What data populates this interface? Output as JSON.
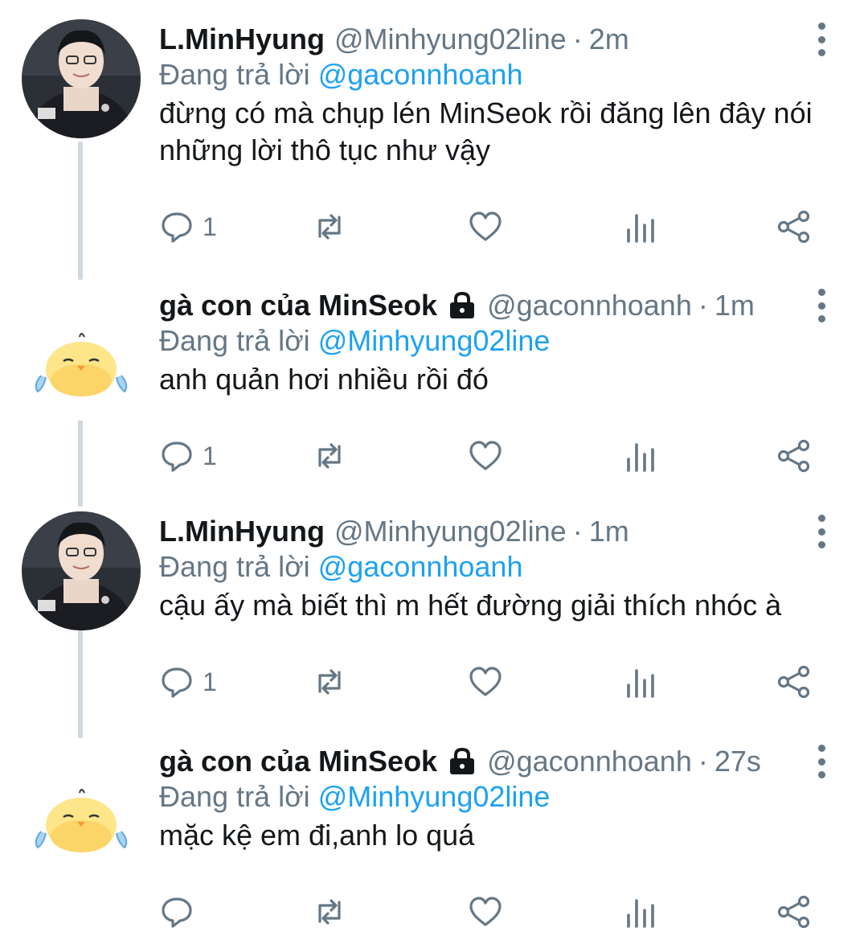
{
  "reply_prefix": "Đang trả lời",
  "colors": {
    "text": "#14171a",
    "muted": "#657786",
    "accent": "#1da1f2",
    "thread_line": "#cfd9de"
  },
  "tweets": [
    {
      "author": "L.MinHyung",
      "handle": "@Minhyung02line",
      "separator": "·",
      "time": "2m",
      "protected": false,
      "reply_to": "@gaconnhoanh",
      "text": "đừng có mà chụp lén MinSeok rồi đăng lên đây nói những lời thô tục như vậy",
      "reply_count": "1",
      "avatar": "person-photo"
    },
    {
      "author": "gà con của MinSeok",
      "handle": "@gaconnhoanh",
      "separator": "·",
      "time": "1m",
      "protected": true,
      "reply_to": "@Minhyung02line",
      "text": "anh quản hơi nhiều rồi đó",
      "reply_count": "1",
      "avatar": "crying-chick"
    },
    {
      "author": "L.MinHyung",
      "handle": "@Minhyung02line",
      "separator": "·",
      "time": "1m",
      "protected": false,
      "reply_to": "@gaconnhoanh",
      "text": "cậu ấy mà biết thì m hết đường giải thích nhóc à",
      "reply_count": "1",
      "avatar": "person-photo"
    },
    {
      "author": "gà con của MinSeok",
      "handle": "@gaconnhoanh",
      "separator": "·",
      "time": "27s",
      "protected": true,
      "reply_to": "@Minhyung02line",
      "text": "mặc kệ em đi,anh lo quá",
      "reply_count": "",
      "avatar": "crying-chick"
    }
  ]
}
